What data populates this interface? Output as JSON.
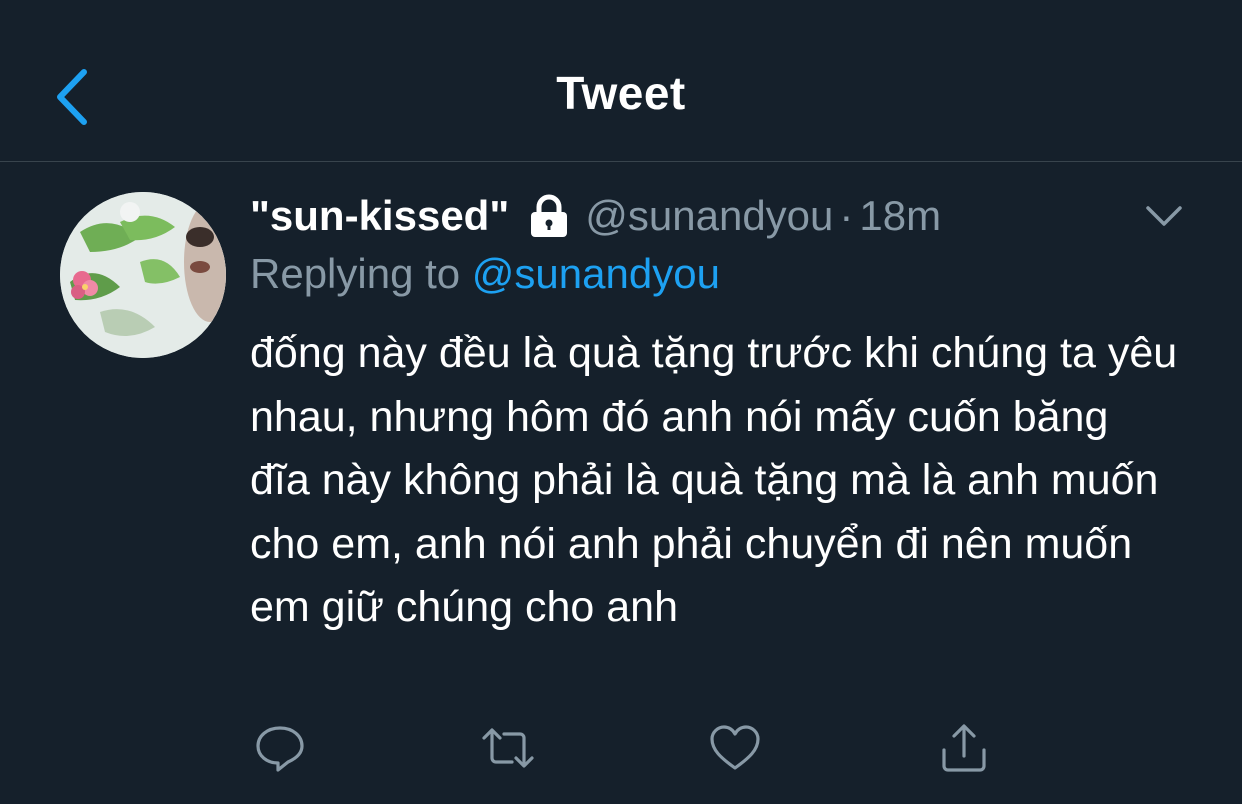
{
  "header": {
    "title": "Tweet",
    "back_icon": "chevron-left-icon"
  },
  "tweet": {
    "display_name": "\"sun-kissed\"",
    "protected_icon": "lock-icon",
    "handle": "@sunandyou",
    "separator": "·",
    "timestamp": "18m",
    "menu_icon": "chevron-down-icon",
    "replying_prefix": "Replying to",
    "replying_to": "@sunandyou",
    "text": "đống này đều là quà tặng trước khi chúng ta yêu nhau, nhưng hôm đó anh nói mấy cuốn băng đĩa này không phải là quà tặng mà là anh muốn cho em, anh nói anh phải chuyển đi nên muốn em giữ chúng cho anh"
  },
  "actions": {
    "reply_icon": "reply-icon",
    "retweet_icon": "retweet-icon",
    "like_icon": "heart-icon",
    "share_icon": "share-icon"
  },
  "colors": {
    "background": "#15202b",
    "accent": "#1da1f2",
    "secondary_text": "#8899a6",
    "divider": "#38444d"
  }
}
